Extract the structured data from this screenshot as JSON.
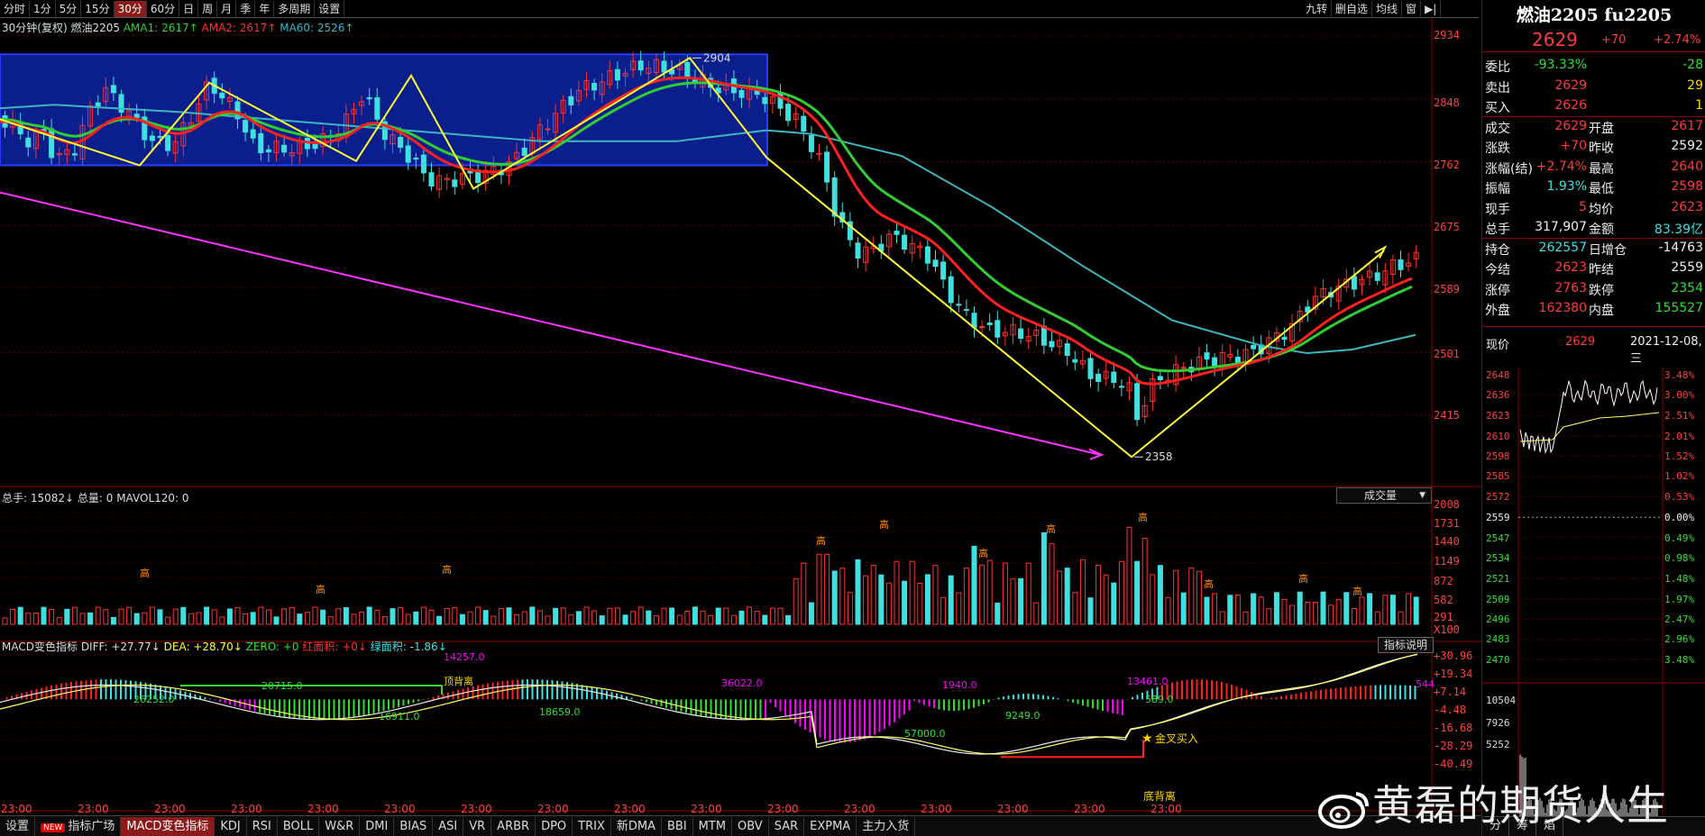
{
  "toolbar": {
    "items": [
      "分时",
      "1分",
      "5分",
      "15分",
      "30分",
      "60分",
      "日",
      "周",
      "月",
      "季",
      "年",
      "多周期",
      "设置"
    ],
    "active": "30分",
    "right_items": [
      "九转",
      "删自选",
      "均线",
      "窗"
    ]
  },
  "main_chart": {
    "legend": {
      "name": "30分钟(复权)",
      "symbol": "燃油2205",
      "ama1": "AMA1: 2617↑",
      "ama2": "AMA2: 2617↑",
      "ma60": "MA60: 2526↑"
    },
    "y_labels": [
      "2934",
      "2848",
      "2762",
      "2675",
      "2589",
      "2501",
      "2415"
    ],
    "annotations": {
      "high": "2904",
      "low": "2358"
    },
    "colors": {
      "ama1": "#32cd32",
      "ama2": "#ff2020",
      "ma60": "#3cb7c0",
      "zigzag": "#ffff33",
      "trend": "#ff33ff",
      "box": "#0a1f8c"
    }
  },
  "volume_panel": {
    "legend": "总手: 15082↓ 总量: 0 MAVOL120: 0",
    "dropdown": "成交量",
    "y_labels": [
      "2008",
      "1731",
      "1440",
      "1149",
      "872",
      "582",
      "291",
      "X100"
    ],
    "tag": "高"
  },
  "macd_panel": {
    "legend": {
      "name": "MACD变色指标",
      "diff": "DIFF: +27.77↓",
      "dea": "DEA: +28.70↓",
      "zero": "ZERO: +0",
      "red_area": "红面积: +0↓",
      "green_area": "绿面积: -1.86↓"
    },
    "help_button": "指标说明",
    "y_labels": [
      "+30.96",
      "+19.34",
      "+7.14",
      "-4.48",
      "-16.68",
      "-28.29",
      "-40.49"
    ],
    "area_labels": [
      "26252.0",
      "20715.0",
      "16911.0",
      "14257.0",
      "顶背离",
      "18659.0",
      "36022.0",
      "57000.0",
      "1940.0",
      "9249.0",
      "13461.0",
      "589.0",
      "544"
    ],
    "golden_cross": "金叉买入",
    "bottom_div": "底背离"
  },
  "x_labels": [
    "23:00",
    "23:00",
    "23:00",
    "23:00",
    "23:00",
    "23:00",
    "23:00",
    "23:00",
    "23:00",
    "23:00",
    "23:00",
    "23:00",
    "23:00",
    "23:00",
    "23:00",
    "23:00",
    "23:00",
    "23:00"
  ],
  "bottom_tabs": {
    "items": [
      "设置",
      "指标广场",
      "MACD变色指标",
      "KDJ",
      "RSI",
      "BOLL",
      "W&R",
      "DMI",
      "BIAS",
      "ASI",
      "VR",
      "ARBR",
      "DPO",
      "TRIX",
      "新DMA",
      "BBI",
      "MTM",
      "OBV",
      "SAR",
      "EXPMA",
      "主力入货"
    ],
    "new_badge": "NEW",
    "active": "MACD变色指标"
  },
  "quote": {
    "title": "燃油2205 fu2205",
    "price": "2629",
    "change": "+70",
    "pct": "+2.74%",
    "rows": [
      {
        "l1": "委比",
        "v1": "-93.33%",
        "c1": "green",
        "l2": "",
        "v2": "-28",
        "c2": "green"
      },
      {
        "l1": "卖出",
        "v1": "2629",
        "c1": "red",
        "l2": "",
        "v2": "29",
        "c2": "yellow"
      },
      {
        "l1": "买入",
        "v1": "2626",
        "c1": "red",
        "l2": "",
        "v2": "1",
        "c2": "yellow"
      },
      {
        "l1": "成交",
        "v1": "2629",
        "c1": "red",
        "l2": "开盘",
        "v2": "2617",
        "c2": "red"
      },
      {
        "l1": "涨跌",
        "v1": "+70",
        "c1": "red",
        "l2": "昨收",
        "v2": "2592",
        "c2": "white"
      },
      {
        "l1": "涨幅(结)",
        "v1": "+2.74%",
        "c1": "red",
        "l2": "最高",
        "v2": "2640",
        "c2": "red"
      },
      {
        "l1": "振幅",
        "v1": "1.93%",
        "c1": "cyan",
        "l2": "最低",
        "v2": "2598",
        "c2": "red"
      },
      {
        "l1": "现手",
        "v1": "5",
        "c1": "red",
        "l2": "均价",
        "v2": "2623",
        "c2": "red"
      },
      {
        "l1": "总手",
        "v1": "317,907",
        "c1": "white",
        "l2": "金额",
        "v2": "83.39亿",
        "c2": "cyan"
      },
      {
        "l1": "持仓",
        "v1": "262557",
        "c1": "cyan",
        "l2": "日增仓",
        "v2": "-14763",
        "c2": "white"
      },
      {
        "l1": "今结",
        "v1": "2623",
        "c1": "red",
        "l2": "昨结",
        "v2": "2559",
        "c2": "white"
      },
      {
        "l1": "涨停",
        "v1": "2763",
        "c1": "red",
        "l2": "跌停",
        "v2": "2354",
        "c2": "green"
      },
      {
        "l1": "外盘",
        "v1": "162380",
        "c1": "red",
        "l2": "内盘",
        "v2": "155527",
        "c2": "green"
      }
    ],
    "current_label": "现价",
    "current_price": "2629",
    "date": "2021-12-08,三",
    "mini_left": [
      "2648",
      "2636",
      "2623",
      "2610",
      "2598",
      "2585",
      "2572",
      "2559",
      "2547",
      "2534",
      "2521",
      "2509",
      "2496",
      "2483",
      "2470",
      "10504",
      "7926",
      "5252"
    ],
    "mini_right": [
      "3.48%",
      "3.00%",
      "2.51%",
      "2.01%",
      "1.52%",
      "1.02%",
      "0.53%",
      "0.00%",
      "0.49%",
      "0.98%",
      "1.48%",
      "1.97%",
      "2.47%",
      "2.96%",
      "3.48%"
    ],
    "bottom_tabs": [
      "分",
      "筹",
      "焰"
    ]
  },
  "watermark": "黄磊的期货人生"
}
